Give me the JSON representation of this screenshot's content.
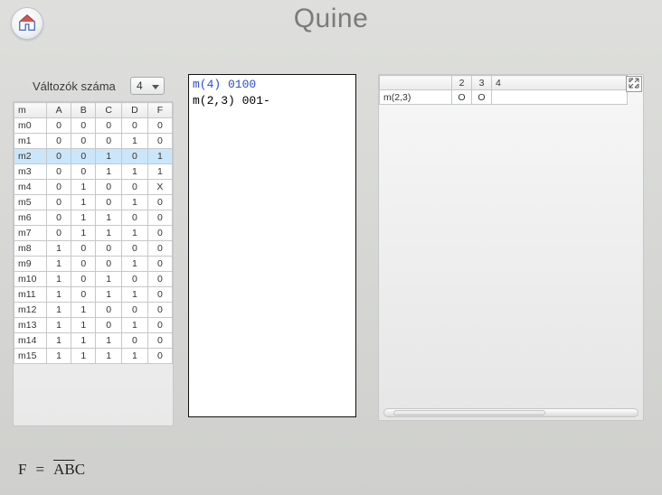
{
  "title": "Quine",
  "var_label": "Változók száma",
  "var_value": "4",
  "table": {
    "headers": [
      "m",
      "A",
      "B",
      "C",
      "D",
      "F"
    ],
    "rows": [
      {
        "m": "m0",
        "v": [
          "0",
          "0",
          "0",
          "0",
          "0"
        ]
      },
      {
        "m": "m1",
        "v": [
          "0",
          "0",
          "0",
          "1",
          "0"
        ]
      },
      {
        "m": "m2",
        "v": [
          "0",
          "0",
          "1",
          "0",
          "1"
        ],
        "selected": true
      },
      {
        "m": "m3",
        "v": [
          "0",
          "0",
          "1",
          "1",
          "1"
        ]
      },
      {
        "m": "m4",
        "v": [
          "0",
          "1",
          "0",
          "0",
          "X"
        ]
      },
      {
        "m": "m5",
        "v": [
          "0",
          "1",
          "0",
          "1",
          "0"
        ]
      },
      {
        "m": "m6",
        "v": [
          "0",
          "1",
          "1",
          "0",
          "0"
        ]
      },
      {
        "m": "m7",
        "v": [
          "0",
          "1",
          "1",
          "1",
          "0"
        ]
      },
      {
        "m": "m8",
        "v": [
          "1",
          "0",
          "0",
          "0",
          "0"
        ]
      },
      {
        "m": "m9",
        "v": [
          "1",
          "0",
          "0",
          "1",
          "0"
        ]
      },
      {
        "m": "m10",
        "v": [
          "1",
          "0",
          "1",
          "0",
          "0"
        ]
      },
      {
        "m": "m11",
        "v": [
          "1",
          "0",
          "1",
          "1",
          "0"
        ]
      },
      {
        "m": "m12",
        "v": [
          "1",
          "1",
          "0",
          "0",
          "0"
        ]
      },
      {
        "m": "m13",
        "v": [
          "1",
          "1",
          "0",
          "1",
          "0"
        ]
      },
      {
        "m": "m14",
        "v": [
          "1",
          "1",
          "1",
          "0",
          "0"
        ]
      },
      {
        "m": "m15",
        "v": [
          "1",
          "1",
          "1",
          "1",
          "0"
        ]
      }
    ]
  },
  "mid_lines": [
    {
      "label": "m(4) ",
      "value": "0100",
      "cls": "blue"
    },
    {
      "label": "m(2,3) ",
      "value": "001-",
      "cls": "black"
    }
  ],
  "cov": {
    "cols": [
      "2",
      "3",
      "4"
    ],
    "rows": [
      {
        "label": "m(2,3)",
        "marks": [
          "O",
          "O",
          ""
        ]
      }
    ]
  },
  "formula": {
    "lhs": "F",
    "eq": "=",
    "terms": [
      {
        "text": "A",
        "over": true
      },
      {
        "text": "B",
        "over": true
      },
      {
        "text": "C",
        "over": false
      }
    ]
  }
}
